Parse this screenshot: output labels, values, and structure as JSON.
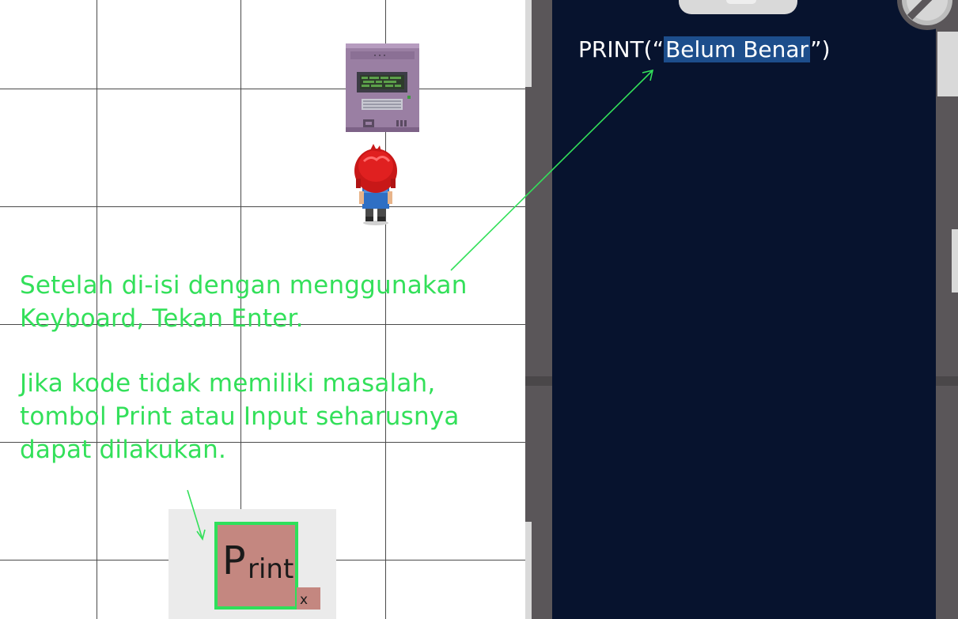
{
  "instruction": {
    "para1_line1": "Setelah di-isi dengan menggunakan",
    "para1_line2": "Keyboard, Tekan Enter.",
    "para2_line1": "Jika kode tidak memiliki masalah,",
    "para2_line2": "tombol Print atau Input seharusnya",
    "para2_line3": "dapat dilakukan."
  },
  "print_button": {
    "big_letter": "P",
    "rest_label": "rint"
  },
  "close_label": "x",
  "code": {
    "prefix": "PRINT(“",
    "highlighted": "Belum Benar",
    "suffix": "”)"
  },
  "colors": {
    "annotation_green": "#33e05a",
    "code_panel_bg": "#07132e",
    "highlight_bg": "#1d4e8c",
    "print_button_bg": "#c48780",
    "print_button_border": "#2ee05a",
    "frame_gray": "#5a5659"
  },
  "icons": {
    "computer": "computer-terminal-icon",
    "player": "red-haired-player-icon",
    "badge": "no-entry-badge-icon"
  }
}
